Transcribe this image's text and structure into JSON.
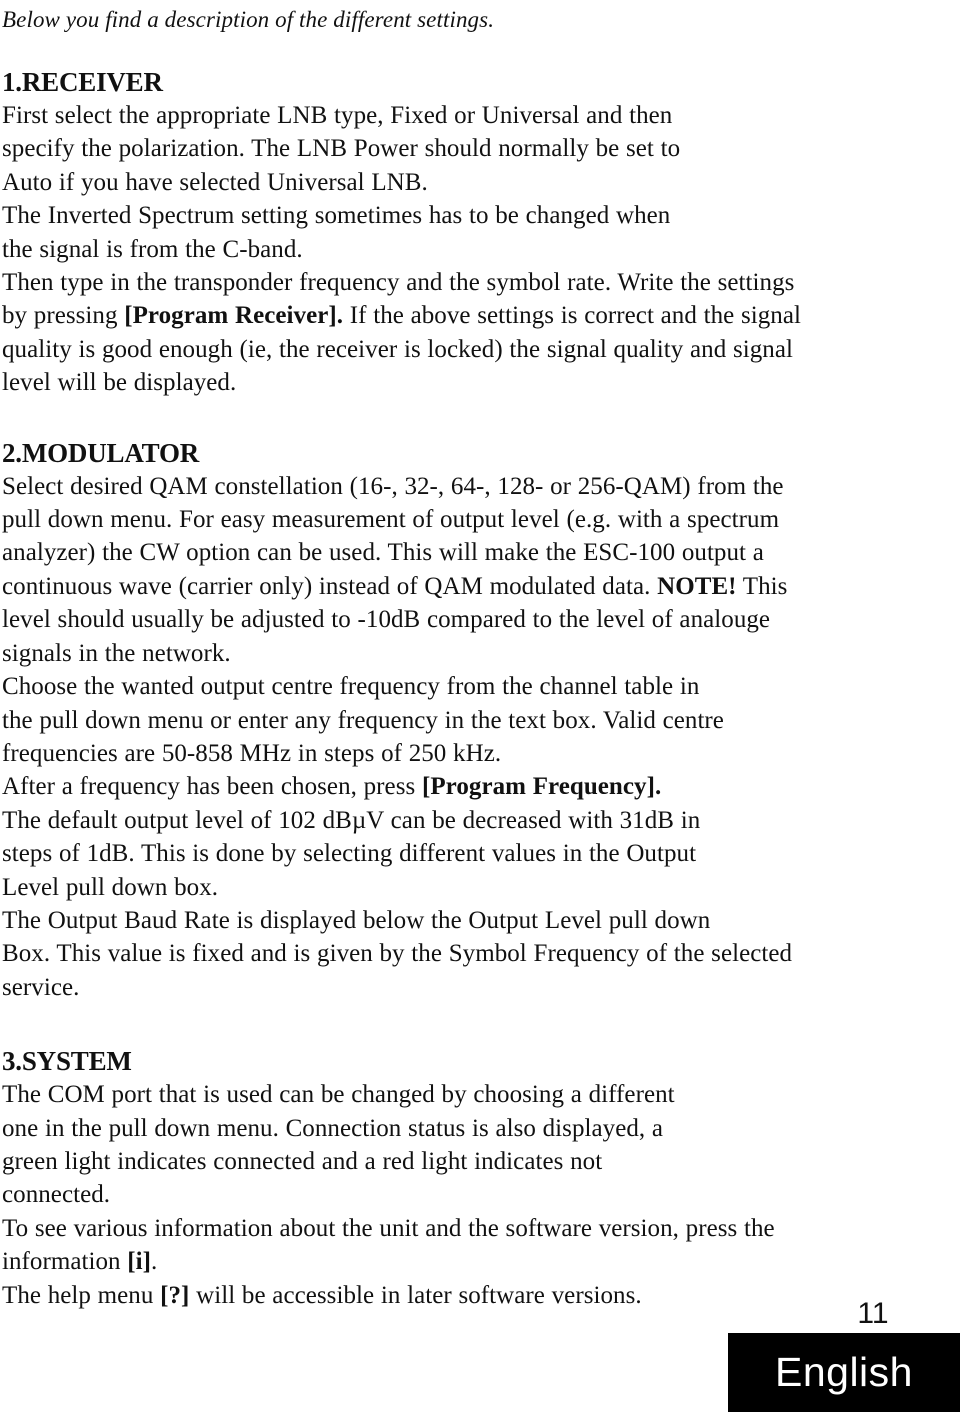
{
  "document": {
    "intro_line": "Below you find a description of the different settings.",
    "page_number": "11",
    "language_tab": "English",
    "sections": [
      {
        "heading": "1.RECEIVER",
        "paragraphs": [
          {
            "lines": [
              "First select the appropriate LNB type, Fixed or Universal and then",
              "specify the polarization. The LNB Power should normally be set to",
              "Auto if you have selected Universal LNB."
            ]
          },
          {
            "lines": [
              "The Inverted Spectrum setting sometimes has to be changed when",
              "the signal is from the C-band."
            ]
          },
          {
            "text_before_bold": "Then type in the transponder frequency and the symbol rate. Write the settings by pressing ",
            "bold": "[Program Receiver].",
            "text_after_bold": " If the above settings is correct and the signal quality is good enough (ie, the receiver is locked) the signal quality and signal level will be displayed."
          }
        ]
      },
      {
        "heading": "2.MODULATOR",
        "paragraphs": [
          {
            "text_before_bold": "Select desired QAM constellation (16-, 32-, 64-, 128- or 256-QAM) from the pull down menu. For easy measurement of output level (e.g. with a spectrum analyzer) the CW option can be used. This will make the ESC-100 output a continuous wave (carrier only) instead of QAM modulated data. ",
            "bold": "NOTE!",
            "text_after_bold": " This level should usually be adjusted to -10dB compared to the level of analouge signals in the network."
          },
          {
            "lines": [
              "Choose the wanted output centre frequency from the channel table in",
              "the pull down menu or enter any frequency in the text box. Valid centre",
              "frequencies are 50-858 MHz in steps of 250 kHz."
            ]
          },
          {
            "text_before_bold": "After a frequency has been chosen, press ",
            "bold": "[Program Frequency].",
            "text_after_bold": ""
          },
          {
            "lines": [
              "The default output level of 102 dBµV can be decreased with 31dB in",
              "steps of 1dB. This is done by selecting different values in the Output",
              "Level pull down box."
            ]
          },
          {
            "lines": [
              "The Output Baud Rate is displayed below the Output Level pull down",
              "Box. This value is fixed and is given by the Symbol Frequency of the selected",
              "service."
            ]
          }
        ]
      },
      {
        "heading": "3.SYSTEM",
        "paragraphs": [
          {
            "lines": [
              "The COM port that is used can be changed by choosing a different",
              "one in the pull down menu. Connection status is also displayed, a",
              "green light indicates connected and a red light indicates not",
              "connected."
            ]
          },
          {
            "text_before_bold": "To see various information about the unit and the software version, press the information ",
            "bold": "[i]",
            "text_after_bold": "."
          },
          {
            "text_before_bold": "The help menu ",
            "bold": "[?]",
            "text_after_bold": " will be accessible in later software versions."
          }
        ]
      }
    ]
  }
}
